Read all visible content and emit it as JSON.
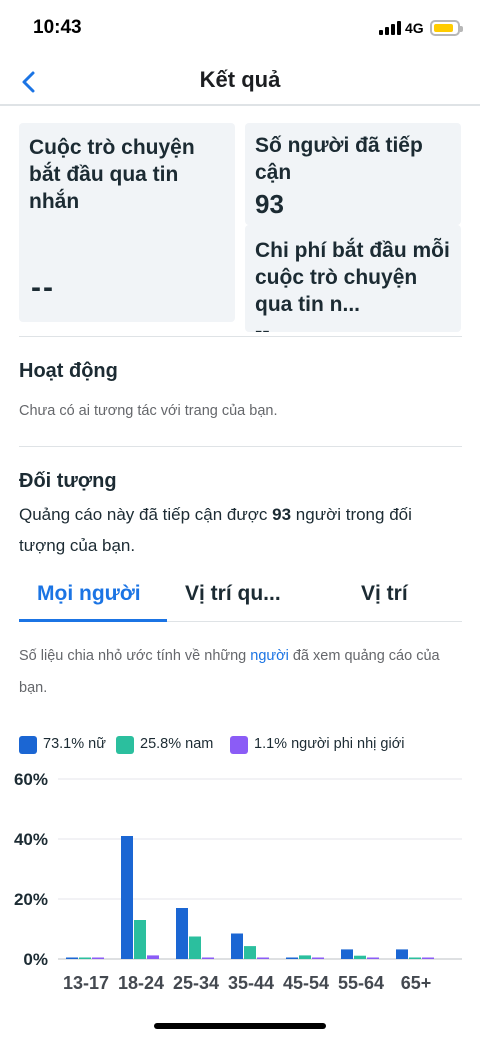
{
  "status_bar": {
    "time": "10:43",
    "network": "4G"
  },
  "nav": {
    "title": "Kết quả",
    "back_icon": "chevron-left-icon"
  },
  "metrics": [
    {
      "title": "Cuộc trò chuyện bắt đầu qua tin nhắn",
      "value": "--"
    },
    {
      "title": "Số người đã tiếp cận",
      "value": "93"
    },
    {
      "title": "Chi phí bắt đầu mỗi cuộc trò chuyện qua tin n...",
      "value": "--"
    }
  ],
  "activity": {
    "title": "Hoạt động",
    "text": "Chưa có ai tương tác với trang của bạn."
  },
  "audience": {
    "title": "Đối tượng",
    "text_before": "Quảng cáo này đã tiếp cận được ",
    "text_number": "93",
    "text_after": " người trong đối tượng của bạn."
  },
  "tabs": [
    {
      "label": "Mọi người",
      "active": true
    },
    {
      "label": "Vị trí qu...",
      "active": false
    },
    {
      "label": "Vị trí",
      "active": false
    }
  ],
  "note": {
    "before": "Số liệu chia nhỏ ước tính về những ",
    "link": "người",
    "after": " đã xem quảng cáo của bạn."
  },
  "colors": {
    "accent": "#1b74e4",
    "female": "#1b66d3",
    "male": "#2bbf9e",
    "nonbinary": "#8b5cf6"
  },
  "chart_data": {
    "type": "bar",
    "categories": [
      "13-17",
      "18-24",
      "25-34",
      "35-44",
      "45-54",
      "55-64",
      "65+"
    ],
    "series": [
      {
        "name": "73.1% nữ",
        "color": "#1b66d3",
        "values": [
          0,
          41,
          17,
          8.5,
          0.3,
          3.2,
          3.2
        ]
      },
      {
        "name": "25.8% nam",
        "color": "#2bbf9e",
        "values": [
          0.2,
          13,
          7.5,
          4.3,
          1.2,
          1.1,
          0.3
        ]
      },
      {
        "name": "1.1% người phi nhị giới",
        "color": "#8b5cf6",
        "values": [
          0,
          1.2,
          0,
          0,
          0,
          0,
          0
        ]
      }
    ],
    "y_ticks": [
      "60%",
      "40%",
      "20%",
      "0%"
    ],
    "ylim": [
      0,
      60
    ],
    "grid": true
  }
}
